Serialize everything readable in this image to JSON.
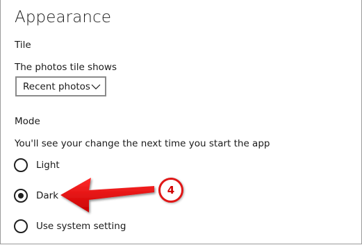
{
  "page": {
    "title": "Appearance"
  },
  "tile": {
    "header": "Tile",
    "description": "The photos tile shows",
    "dropdown_value": "Recent photos"
  },
  "mode": {
    "header": "Mode",
    "description": "You'll see your change the next time you start the app",
    "options": [
      {
        "label": "Light",
        "selected": false
      },
      {
        "label": "Dark",
        "selected": true
      },
      {
        "label": "Use system setting",
        "selected": false
      }
    ]
  },
  "annotation": {
    "step_number": "4",
    "color": "#e01616",
    "icon": "arrow-left-icon"
  }
}
